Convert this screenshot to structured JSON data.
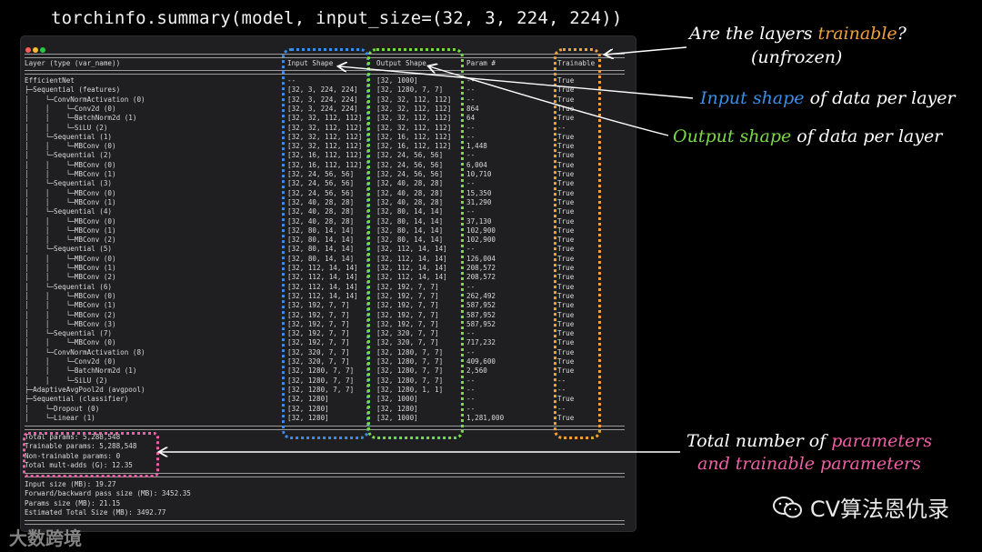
{
  "command": "torchinfo.summary(model, input_size=(32, 3, 224, 224))",
  "window": {
    "dots": [
      "#ff5f57",
      "#febc2e",
      "#28c840"
    ]
  },
  "headers": {
    "name": "Layer (type (var_name))",
    "input": "Input Shape",
    "output": "Output Shape",
    "params": "Param #",
    "trainable": "Trainable"
  },
  "rows": [
    {
      "name": "EfficientNet",
      "in": "--",
      "out": "[32, 1000]",
      "p": "--",
      "t": "True"
    },
    {
      "name": "├─Sequential (features)",
      "in": "[32, 3, 224, 224]",
      "out": "[32, 1280, 7, 7]",
      "p": "--",
      "t": "True"
    },
    {
      "name": "│    └─ConvNormActivation (0)",
      "in": "[32, 3, 224, 224]",
      "out": "[32, 32, 112, 112]",
      "p": "--",
      "t": "True"
    },
    {
      "name": "│    │    └─Conv2d (0)",
      "in": "[32, 3, 224, 224]",
      "out": "[32, 32, 112, 112]",
      "p": "864",
      "t": "True"
    },
    {
      "name": "│    │    └─BatchNorm2d (1)",
      "in": "[32, 32, 112, 112]",
      "out": "[32, 32, 112, 112]",
      "p": "64",
      "t": "True"
    },
    {
      "name": "│    │    └─SiLU (2)",
      "in": "[32, 32, 112, 112]",
      "out": "[32, 32, 112, 112]",
      "p": "--",
      "t": "--"
    },
    {
      "name": "│    └─Sequential (1)",
      "in": "[32, 32, 112, 112]",
      "out": "[32, 16, 112, 112]",
      "p": "--",
      "t": "True"
    },
    {
      "name": "│    │    └─MBConv (0)",
      "in": "[32, 32, 112, 112]",
      "out": "[32, 16, 112, 112]",
      "p": "1,448",
      "t": "True"
    },
    {
      "name": "│    └─Sequential (2)",
      "in": "[32, 16, 112, 112]",
      "out": "[32, 24, 56, 56]",
      "p": "--",
      "t": "True"
    },
    {
      "name": "│    │    └─MBConv (0)",
      "in": "[32, 16, 112, 112]",
      "out": "[32, 24, 56, 56]",
      "p": "6,004",
      "t": "True"
    },
    {
      "name": "│    │    └─MBConv (1)",
      "in": "[32, 24, 56, 56]",
      "out": "[32, 24, 56, 56]",
      "p": "10,710",
      "t": "True"
    },
    {
      "name": "│    └─Sequential (3)",
      "in": "[32, 24, 56, 56]",
      "out": "[32, 40, 28, 28]",
      "p": "--",
      "t": "True"
    },
    {
      "name": "│    │    └─MBConv (0)",
      "in": "[32, 24, 56, 56]",
      "out": "[32, 40, 28, 28]",
      "p": "15,350",
      "t": "True"
    },
    {
      "name": "│    │    └─MBConv (1)",
      "in": "[32, 40, 28, 28]",
      "out": "[32, 40, 28, 28]",
      "p": "31,290",
      "t": "True"
    },
    {
      "name": "│    └─Sequential (4)",
      "in": "[32, 40, 28, 28]",
      "out": "[32, 80, 14, 14]",
      "p": "--",
      "t": "True"
    },
    {
      "name": "│    │    └─MBConv (0)",
      "in": "[32, 40, 28, 28]",
      "out": "[32, 80, 14, 14]",
      "p": "37,130",
      "t": "True"
    },
    {
      "name": "│    │    └─MBConv (1)",
      "in": "[32, 80, 14, 14]",
      "out": "[32, 80, 14, 14]",
      "p": "102,900",
      "t": "True"
    },
    {
      "name": "│    │    └─MBConv (2)",
      "in": "[32, 80, 14, 14]",
      "out": "[32, 80, 14, 14]",
      "p": "102,900",
      "t": "True"
    },
    {
      "name": "│    └─Sequential (5)",
      "in": "[32, 80, 14, 14]",
      "out": "[32, 112, 14, 14]",
      "p": "--",
      "t": "True"
    },
    {
      "name": "│    │    └─MBConv (0)",
      "in": "[32, 80, 14, 14]",
      "out": "[32, 112, 14, 14]",
      "p": "126,004",
      "t": "True"
    },
    {
      "name": "│    │    └─MBConv (1)",
      "in": "[32, 112, 14, 14]",
      "out": "[32, 112, 14, 14]",
      "p": "208,572",
      "t": "True"
    },
    {
      "name": "│    │    └─MBConv (2)",
      "in": "[32, 112, 14, 14]",
      "out": "[32, 112, 14, 14]",
      "p": "208,572",
      "t": "True"
    },
    {
      "name": "│    └─Sequential (6)",
      "in": "[32, 112, 14, 14]",
      "out": "[32, 192, 7, 7]",
      "p": "--",
      "t": "True"
    },
    {
      "name": "│    │    └─MBConv (0)",
      "in": "[32, 112, 14, 14]",
      "out": "[32, 192, 7, 7]",
      "p": "262,492",
      "t": "True"
    },
    {
      "name": "│    │    └─MBConv (1)",
      "in": "[32, 192, 7, 7]",
      "out": "[32, 192, 7, 7]",
      "p": "587,952",
      "t": "True"
    },
    {
      "name": "│    │    └─MBConv (2)",
      "in": "[32, 192, 7, 7]",
      "out": "[32, 192, 7, 7]",
      "p": "587,952",
      "t": "True"
    },
    {
      "name": "│    │    └─MBConv (3)",
      "in": "[32, 192, 7, 7]",
      "out": "[32, 192, 7, 7]",
      "p": "587,952",
      "t": "True"
    },
    {
      "name": "│    └─Sequential (7)",
      "in": "[32, 192, 7, 7]",
      "out": "[32, 320, 7, 7]",
      "p": "--",
      "t": "True"
    },
    {
      "name": "│    │    └─MBConv (0)",
      "in": "[32, 192, 7, 7]",
      "out": "[32, 320, 7, 7]",
      "p": "717,232",
      "t": "True"
    },
    {
      "name": "│    └─ConvNormActivation (8)",
      "in": "[32, 320, 7, 7]",
      "out": "[32, 1280, 7, 7]",
      "p": "--",
      "t": "True"
    },
    {
      "name": "│    │    └─Conv2d (0)",
      "in": "[32, 320, 7, 7]",
      "out": "[32, 1280, 7, 7]",
      "p": "409,600",
      "t": "True"
    },
    {
      "name": "│    │    └─BatchNorm2d (1)",
      "in": "[32, 1280, 7, 7]",
      "out": "[32, 1280, 7, 7]",
      "p": "2,560",
      "t": "True"
    },
    {
      "name": "│    │    └─SiLU (2)",
      "in": "[32, 1280, 7, 7]",
      "out": "[32, 1280, 7, 7]",
      "p": "--",
      "t": "--"
    },
    {
      "name": "├─AdaptiveAvgPool2d (avgpool)",
      "in": "[32, 1280, 7, 7]",
      "out": "[32, 1280, 1, 1]",
      "p": "--",
      "t": "--"
    },
    {
      "name": "├─Sequential (classifier)",
      "in": "[32, 1280]",
      "out": "[32, 1000]",
      "p": "--",
      "t": "True"
    },
    {
      "name": "│    └─Dropout (0)",
      "in": "[32, 1280]",
      "out": "[32, 1280]",
      "p": "--",
      "t": "--"
    },
    {
      "name": "│    └─Linear (1)",
      "in": "[32, 1280]",
      "out": "[32, 1000]",
      "p": "1,281,000",
      "t": "True"
    }
  ],
  "totals": [
    "Total params: 5,288,548",
    "Trainable params: 5,288,548",
    "Non-trainable params: 0",
    "Total mult-adds (G): 12.35"
  ],
  "sizes": [
    "Input size (MB): 19.27",
    "Forward/backward pass size (MB): 3452.35",
    "Params size (MB): 21.15",
    "Estimated Total Size (MB): 3492.77"
  ],
  "annotations": {
    "trainable_pre": "Are the layers ",
    "trainable_hl": "trainable",
    "trainable_post": "?",
    "trainable_line2": "(unfrozen)",
    "input_hl": "Input shape",
    "input_post": " of data per layer",
    "output_hl": "Output shape",
    "output_post": " of data per layer",
    "total_pre": "Total number of ",
    "total_hl1": "parameters",
    "total_hl2": "and trainable parameters"
  },
  "colors": {
    "blue": "#3a8ee8",
    "green": "#7ad84a",
    "orange": "#f0a23a",
    "pink": "#ef5fa6"
  },
  "watermark": {
    "brand": "CV算法恩仇录",
    "corner": "大数跨境"
  }
}
